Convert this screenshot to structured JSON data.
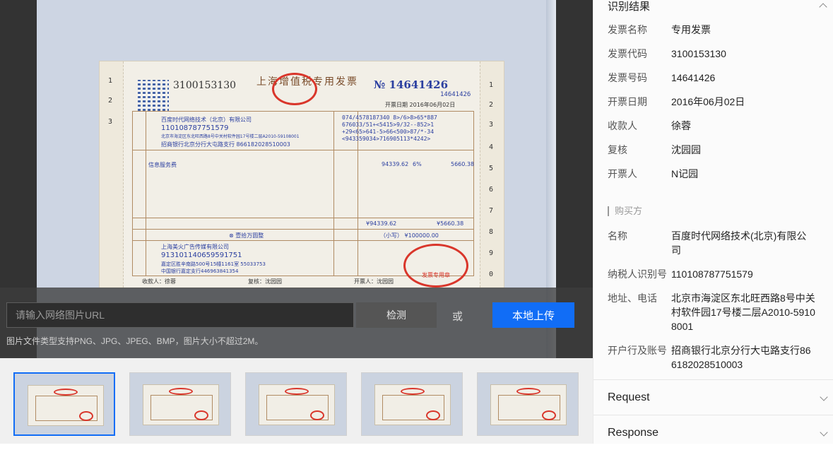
{
  "scan": {
    "invoice_code": "3100153130",
    "invoice_title": "上海增值税专用发票",
    "invoice_no_mark": "№",
    "invoice_no": "14641426",
    "invoice_no_small": "14641426",
    "date_text": "开票日期 2016年06月02日",
    "buyer_name": "百度时代网络技术（北京）有限公司",
    "buyer_tax": "110108787751579",
    "buyer_addr": "北京市海淀区东北旺西路8号中关村软件园17号楼二层A2010-59108001",
    "buyer_bank": "招商银行北京分行大屯路支行 866182028510003",
    "cipher": "074/4578187340 8>/6>8>65*887\n676033/51+<5415>9/32--852>1\n+29<65>641-5>66<500>87/*-34\n<943359034>716905113*4242>",
    "item": "信息服务费",
    "amount": "94339.62",
    "rate": "6%",
    "tax": "5660.38",
    "total_amount": "¥94339.62",
    "total_tax": "¥5660.38",
    "total_words": "⊗ 壹拾万圆整",
    "total_small": "（小写） ¥100000.00",
    "seller_name": "上海美火广告传媒有限公司",
    "seller_tax": "913101140659591751",
    "seller_addr": "嘉定区胜辛南路500号15幢1161室 55033753",
    "seller_bank": "中国银行嘉定支行446963841354",
    "payee": "收款人：徐蓉",
    "checker": "复核：沈园园",
    "issuer": "开票人：沈园园",
    "stamp_text": "发票专用章",
    "left_nums": [
      "1",
      "2",
      "3"
    ],
    "right_nums": [
      "1",
      "2",
      "3",
      "4",
      "5",
      "6",
      "7",
      "8",
      "9",
      "0"
    ]
  },
  "uploader": {
    "url_placeholder": "请输入网络图片URL",
    "detect_label": "检测",
    "or_label": "或",
    "upload_label": "本地上传",
    "hint": "图片文件类型支持PNG、JPG、JPEG、BMP，图片大小不超过2M。"
  },
  "results": {
    "title": "识别结果",
    "fields": [
      {
        "key": "发票名称",
        "value": "专用发票"
      },
      {
        "key": "发票代码",
        "value": "3100153130"
      },
      {
        "key": "发票号码",
        "value": "14641426"
      },
      {
        "key": "开票日期",
        "value": "2016年06月02日"
      },
      {
        "key": "收款人",
        "value": "徐蓉"
      },
      {
        "key": "复核",
        "value": "沈园园"
      },
      {
        "key": "开票人",
        "value": "N记园"
      }
    ],
    "buyer_title": "购买方",
    "buyer_fields": [
      {
        "key": "名称",
        "value": "百度时代网络技术(北京)有限公司"
      },
      {
        "key": "纳税人识别号",
        "value": "110108787751579"
      },
      {
        "key": "地址、电话",
        "value": "北京市海淀区东北旺西路8号中关村软件园17号楼二层A2010-59108001"
      },
      {
        "key": "开户行及账号",
        "value": "招商银行北京分行大屯路支行866182028510003"
      }
    ]
  },
  "accordions": {
    "request": "Request",
    "response": "Response"
  },
  "colors": {
    "accent": "#116df6",
    "stamp_red": "#d9362b",
    "ink_blue": "#2b3fa0"
  }
}
